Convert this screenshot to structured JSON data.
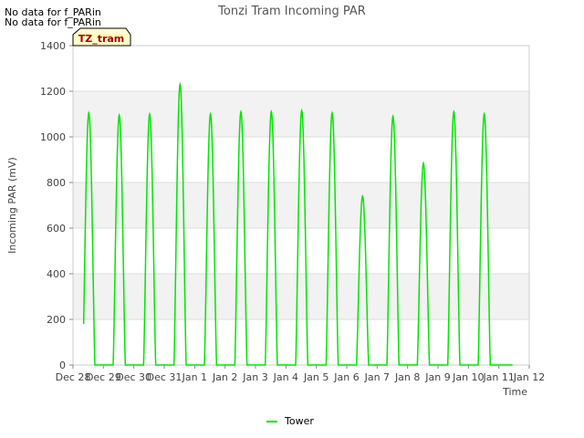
{
  "notes": [
    "No data for f_PARin",
    "No data for f_PARin"
  ],
  "tag": "TZ_tram",
  "colors": {
    "line": "#00e600",
    "band": "#f2f2f2",
    "grid": "#dddddd",
    "tag_bg": "#ffffcc",
    "tag_text": "#aa0000"
  },
  "chart_data": {
    "type": "line",
    "title": "Tonzi Tram Incoming PAR",
    "xlabel": "Time",
    "ylabel": "Incoming PAR (mV)",
    "ylim": [
      0,
      1400
    ],
    "yticks": [
      0,
      200,
      400,
      600,
      800,
      1000,
      1200,
      1400
    ],
    "xlim": [
      0,
      15
    ],
    "xtick_labels": [
      "Dec 28",
      "Dec 29",
      "Dec 30",
      "Dec 31",
      "Jan 1",
      "Jan 2",
      "Jan 3",
      "Jan 4",
      "Jan 5",
      "Jan 6",
      "Jan 7",
      "Jan 8",
      "Jan 9",
      "Jan 10",
      "Jan 11",
      "Jan 12"
    ],
    "grid": true,
    "legend_position": "bottom-center",
    "series": [
      {
        "name": "Tower",
        "daily_peaks": [
          {
            "day": "Dec 28",
            "peak": 1105
          },
          {
            "day": "Dec 29",
            "peak": 1095
          },
          {
            "day": "Dec 30",
            "peak": 1100
          },
          {
            "day": "Dec 31",
            "peak": 1230
          },
          {
            "day": "Jan 1",
            "peak": 1100
          },
          {
            "day": "Jan 2",
            "peak": 1110
          },
          {
            "day": "Jan 3",
            "peak": 1110
          },
          {
            "day": "Jan 4",
            "peak": 1115
          },
          {
            "day": "Jan 5",
            "peak": 1105
          },
          {
            "day": "Jan 6",
            "peak": 740
          },
          {
            "day": "Jan 7",
            "peak": 1090
          },
          {
            "day": "Jan 8",
            "peak": 885
          },
          {
            "day": "Jan 9",
            "peak": 1110
          },
          {
            "day": "Jan 10",
            "peak": 1100
          }
        ]
      }
    ]
  }
}
